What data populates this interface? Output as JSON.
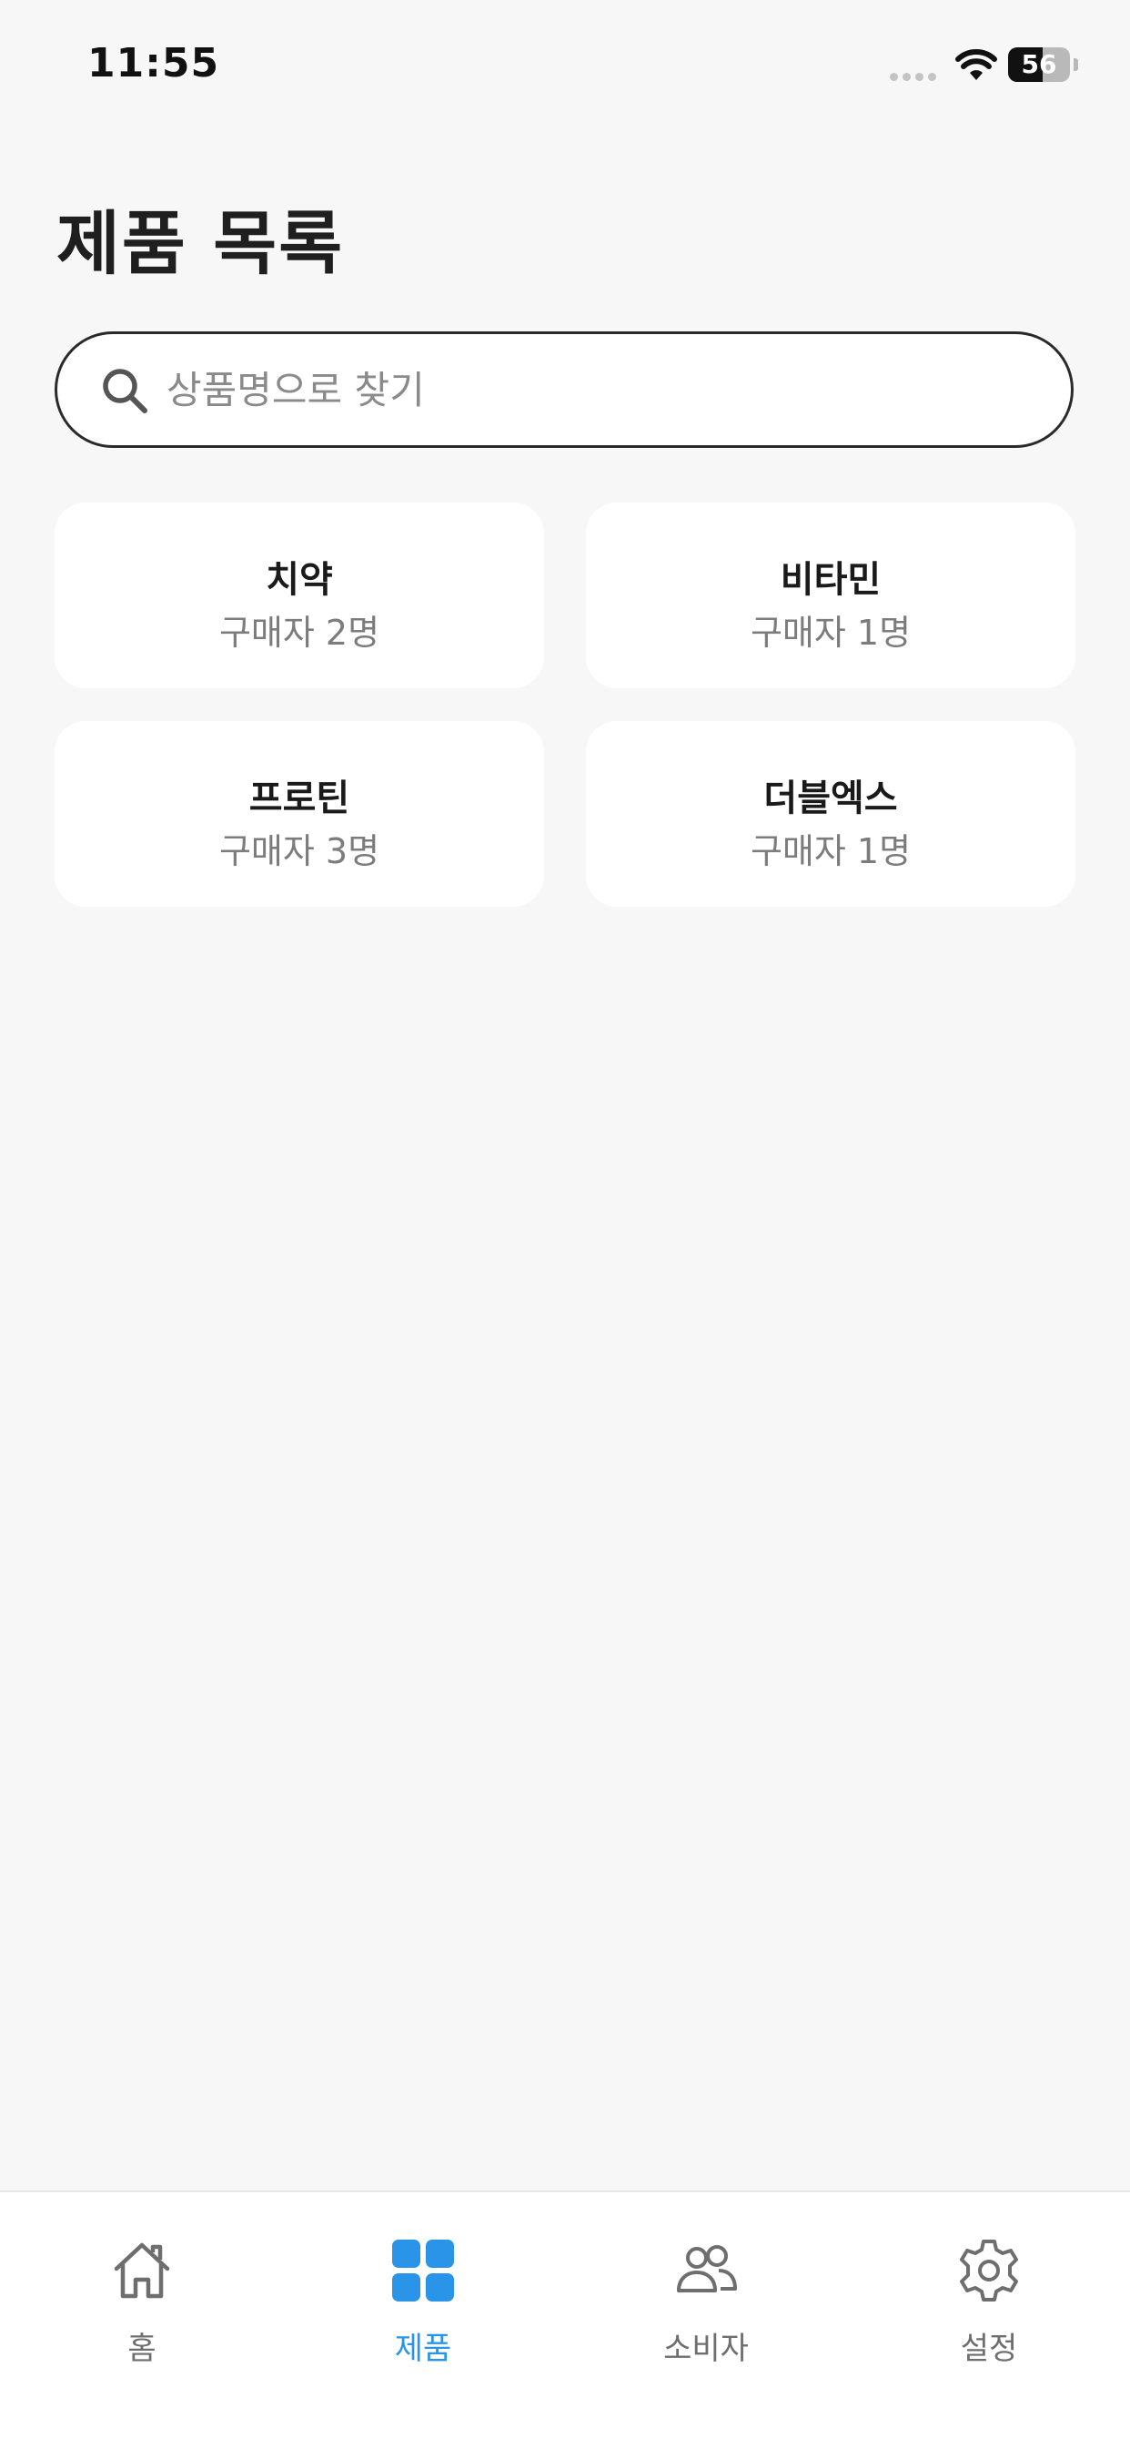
{
  "status_bar": {
    "time": "11:55",
    "battery": "56"
  },
  "page": {
    "title": "제품 목록"
  },
  "search": {
    "placeholder": "상품명으로 찾기",
    "value": ""
  },
  "products": [
    {
      "name": "치약",
      "buyers": "구매자 2명"
    },
    {
      "name": "비타민",
      "buyers": "구매자 1명"
    },
    {
      "name": "프로틴",
      "buyers": "구매자 3명"
    },
    {
      "name": "더블엑스",
      "buyers": "구매자 1명"
    }
  ],
  "tab_bar": {
    "active_color": "#2a95e8",
    "inactive_color": "#6e6e6e",
    "tabs": [
      {
        "label": "홈",
        "icon": "home-icon"
      },
      {
        "label": "제품",
        "icon": "grid-icon",
        "active": true
      },
      {
        "label": "소비자",
        "icon": "people-icon"
      },
      {
        "label": "설정",
        "icon": "gear-icon"
      }
    ]
  }
}
